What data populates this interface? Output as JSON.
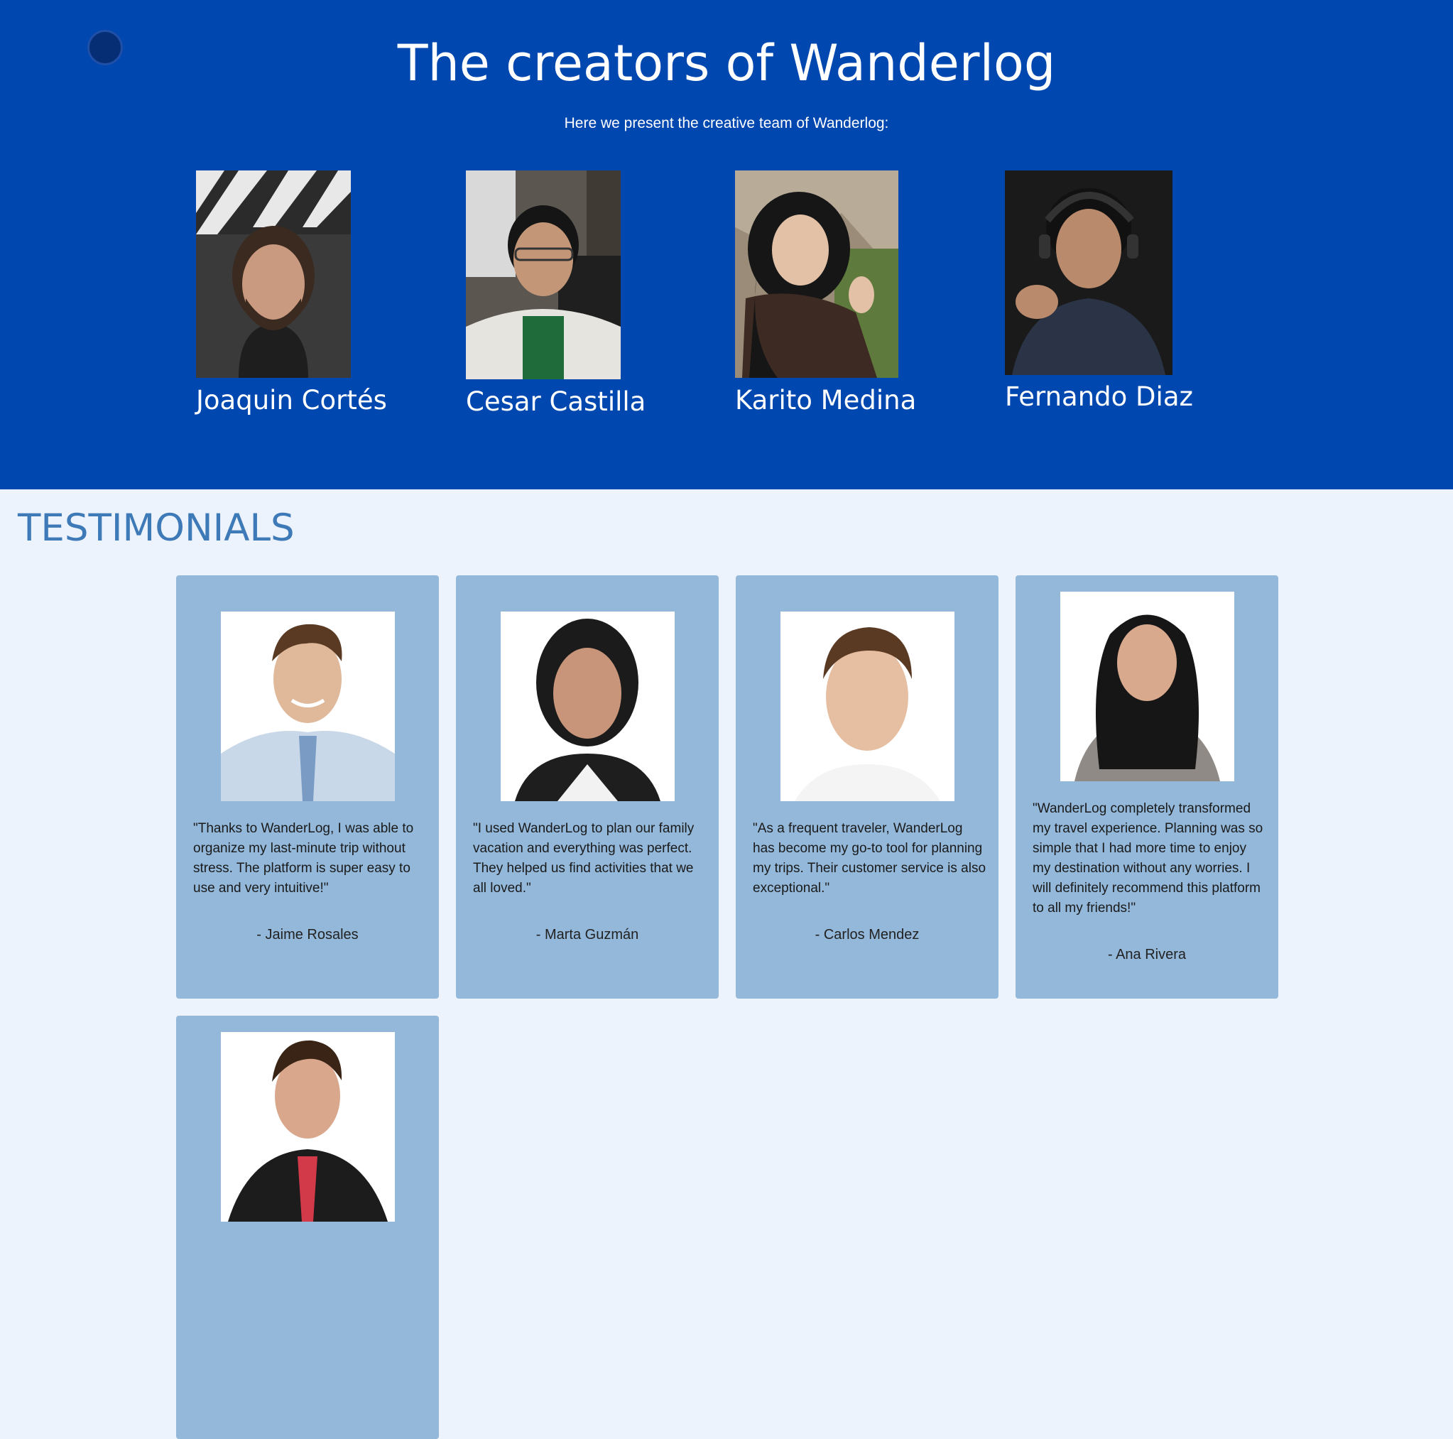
{
  "colors": {
    "hero_bg": "#0047b0",
    "page_bg": "#edf3fd",
    "card_bg": "#93b8da",
    "heading": "#3d7ab7"
  },
  "hero": {
    "title": "The creators of Wanderlog",
    "subtitle": "Here we present the creative team of Wanderlog:",
    "creators": [
      {
        "name": "Joaquin Cortés"
      },
      {
        "name": "Cesar Castilla"
      },
      {
        "name": "Karito Medina"
      },
      {
        "name": "Fernando Diaz"
      }
    ]
  },
  "testimonials": {
    "heading": "TESTIMONIALS",
    "cards": [
      {
        "quote": "\"Thanks to WanderLog, I was able to organize my last-minute trip without stress. The platform is super easy to use and very intuitive!\"",
        "author": "- Jaime Rosales"
      },
      {
        "quote": "\"I used WanderLog to plan our family vacation and everything was perfect. They helped us find activities that we all loved.\"",
        "author": "- Marta Guzmán"
      },
      {
        "quote": "\"As a frequent traveler, WanderLog has become my go-to tool for planning my trips. Their customer service is also exceptional.\"",
        "author": "- Carlos Mendez"
      },
      {
        "quote": "\"WanderLog completely transformed my travel experience. Planning was so simple that I had more time to enjoy my destination without any worries. I will definitely recommend this platform to all my friends!\"",
        "author": "- Ana Rivera"
      }
    ]
  }
}
